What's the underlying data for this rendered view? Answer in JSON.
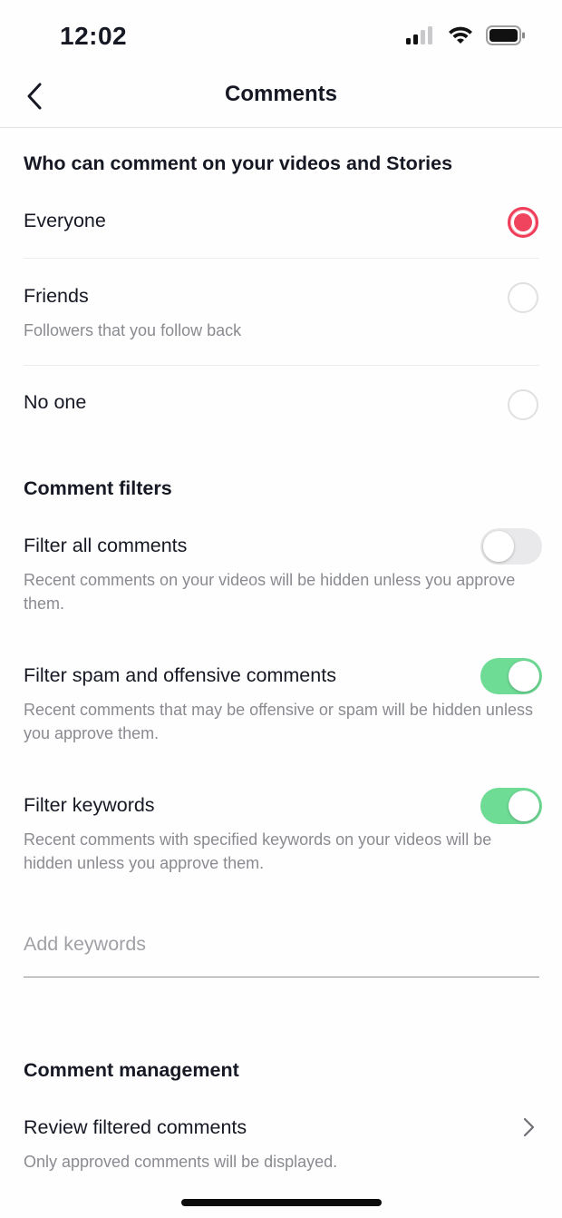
{
  "status": {
    "time": "12:02"
  },
  "header": {
    "title": "Comments"
  },
  "who_can_comment": {
    "title": "Who can comment on your videos and Stories",
    "options": [
      {
        "label": "Everyone",
        "sub": "",
        "selected": true
      },
      {
        "label": "Friends",
        "sub": "Followers that you follow back",
        "selected": false
      },
      {
        "label": "No one",
        "sub": "",
        "selected": false
      }
    ]
  },
  "filters": {
    "title": "Comment filters",
    "items": [
      {
        "label": "Filter all comments",
        "sub": "Recent comments on your videos will be hidden unless you approve them.",
        "enabled": false
      },
      {
        "label": "Filter spam and offensive comments",
        "sub": "Recent comments that may be offensive or spam will be hidden unless you approve them.",
        "enabled": true
      },
      {
        "label": "Filter keywords",
        "sub": "Recent comments with specified keywords on your videos will be hidden unless you approve them.",
        "enabled": true
      }
    ],
    "keywords_placeholder": "Add keywords"
  },
  "management": {
    "title": "Comment management",
    "review_label": "Review filtered comments",
    "review_sub": "Only approved comments will be displayed."
  },
  "colors": {
    "accent": "#fe2c55",
    "toggle_on": "#6fdc96",
    "toggle_off": "#e9e9eb"
  },
  "icons": {
    "back": "chevron-left-icon",
    "forward": "chevron-right-icon",
    "signal": "cellular-signal-icon",
    "wifi": "wifi-icon",
    "battery": "battery-icon"
  }
}
